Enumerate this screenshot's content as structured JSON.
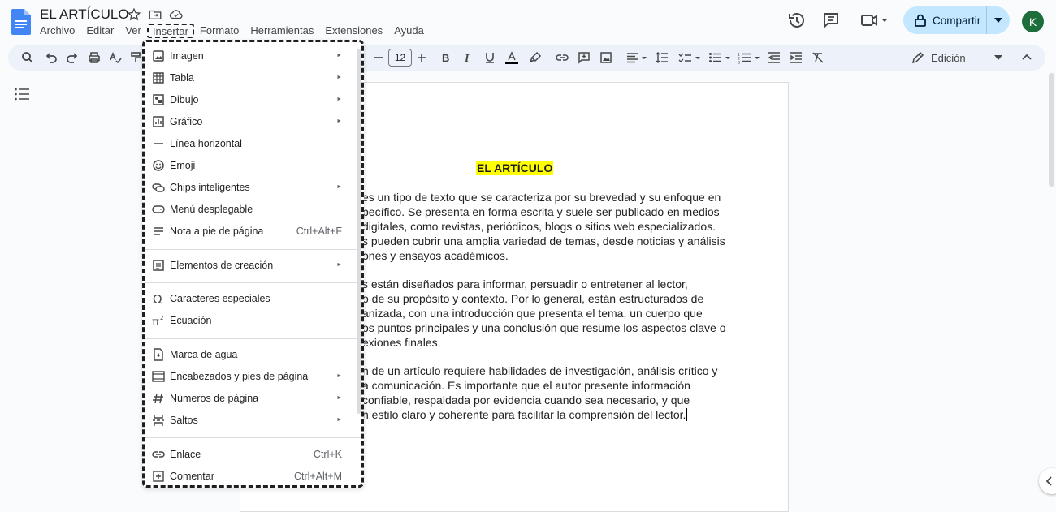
{
  "app": {
    "doc_title": "EL ARTÍCULO"
  },
  "menubar": [
    "Archivo",
    "Editar",
    "Ver",
    "Insertar",
    "Formato",
    "Herramientas",
    "Extensiones",
    "Ayuda"
  ],
  "header": {
    "share_label": "Compartir",
    "avatar_initial": "K",
    "share_color": "#c2e7ff",
    "avatar_color": "#1e6e3b"
  },
  "toolbar": {
    "font_size": "12",
    "mode_label": "Edición"
  },
  "insert_menu": {
    "items": [
      {
        "label": "Imagen",
        "icon": "image-icon",
        "submenu": true
      },
      {
        "label": "Tabla",
        "icon": "table-icon",
        "submenu": true
      },
      {
        "label": "Dibujo",
        "icon": "drawing-icon",
        "submenu": true
      },
      {
        "label": "Gráfico",
        "icon": "chart-icon",
        "submenu": true
      },
      {
        "label": "Línea horizontal",
        "icon": "horizontal-line-icon"
      },
      {
        "label": "Emoji",
        "icon": "emoji-icon"
      },
      {
        "label": "Chips inteligentes",
        "icon": "smart-chips-icon",
        "submenu": true
      },
      {
        "label": "Menú desplegable",
        "icon": "dropdown-icon"
      },
      {
        "label": "Nota a pie de página",
        "icon": "footnote-icon",
        "shortcut": "Ctrl+Alt+F"
      },
      {
        "label": "Elementos de creación",
        "icon": "building-blocks-icon",
        "submenu": true
      },
      {
        "label": "Caracteres especiales",
        "icon": "omega-icon"
      },
      {
        "label": "Ecuación",
        "icon": "pi-icon"
      },
      {
        "label": "Marca de agua",
        "icon": "watermark-icon"
      },
      {
        "label": "Encabezados y pies de página",
        "icon": "header-footer-icon",
        "submenu": true
      },
      {
        "label": "Números de página",
        "icon": "hash-icon",
        "submenu": true
      },
      {
        "label": "Saltos",
        "icon": "break-icon",
        "submenu": true
      },
      {
        "label": "Enlace",
        "icon": "link-icon",
        "shortcut": "Ctrl+K"
      },
      {
        "label": "Comentar",
        "icon": "add-comment-icon",
        "shortcut": "Ctrl+Alt+M"
      }
    ],
    "submenu_glyph": "►"
  },
  "document": {
    "heading": "EL ARTÍCULO",
    "paragraphs": [
      [
        "es un tipo de texto que se caracteriza por su brevedad y su enfoque en",
        "pecífico. Se presenta en forma escrita y suele ser publicado en medios",
        "digitales, como revistas, periódicos, blogs o sitios web especializados.",
        "s pueden cubrir una amplia variedad de temas, desde noticias y análisis",
        "ones y ensayos académicos."
      ],
      [
        "s están diseñados para informar, persuadir o entretener al lector,",
        "o de su propósito y contexto. Por lo general, están estructurados de",
        "anizada, con una introducción que presenta el tema, un cuerpo que",
        "os puntos principales y una conclusión que resume los aspectos clave o",
        "exiones finales."
      ],
      [
        "n de un artículo requiere habilidades de investigación, análisis crítico y",
        "a comunicación. Es importante que el autor presente información",
        "confiable, respaldada por evidencia cuando sea necesario, y que",
        "n estilo claro y coherente para facilitar la comprensión del lector."
      ]
    ],
    "heading_highlight": "#ffff00"
  }
}
